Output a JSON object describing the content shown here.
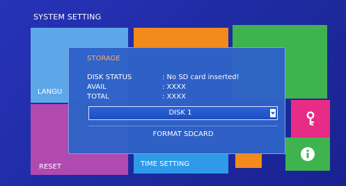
{
  "screen": {
    "title": "SYSTEM SETTING"
  },
  "tiles": {
    "language_label": "LANGU",
    "reset_label": "RESET",
    "time_setting_label": "TIME SETTING",
    "key_icon": "key-icon",
    "info_icon": "info-icon",
    "colors": {
      "light_blue": "#5ea8ea",
      "orange": "#f28a1c",
      "green": "#3fb34e",
      "purple": "#b04ab0",
      "blue": "#2f9be8",
      "pink": "#e62c86"
    }
  },
  "dialog": {
    "title": "STORAGE",
    "rows": [
      {
        "label": "DISK STATUS",
        "value": ": No SD card inserted!"
      },
      {
        "label": "AVAIL",
        "value": ": XXXX"
      },
      {
        "label": "TOTAL",
        "value": ": XXXX"
      }
    ],
    "disk_select": {
      "value": "DISK 1",
      "arrow_icon": "chevron-down-icon"
    },
    "format_button_label": "FORMAT SDCARD",
    "colors": {
      "background": "#2e62c6",
      "title": "#ffa86a"
    }
  }
}
